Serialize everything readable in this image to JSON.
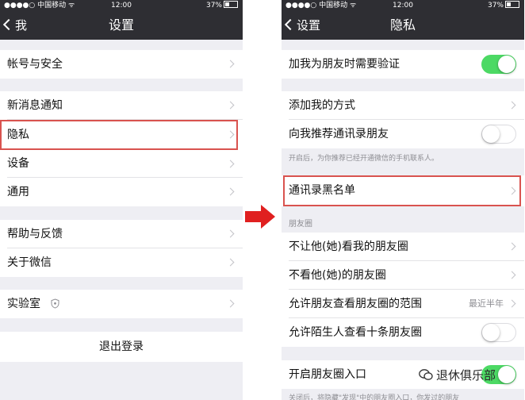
{
  "left": {
    "status": {
      "carrier": "●●●●○ 中国移动 ᯤ",
      "time": "12:00",
      "battery": "37%"
    },
    "nav": {
      "back_label": "我",
      "title": "设置"
    },
    "rows": [
      "帐号与安全",
      "新消息通知",
      "隐私",
      "设备",
      "通用",
      "帮助与反馈",
      "关于微信",
      "实验室"
    ],
    "logout": "退出登录"
  },
  "right": {
    "status": {
      "carrier": "●●●●○ 中国移动 ᯤ",
      "time": "12:00",
      "battery": "37%"
    },
    "nav": {
      "back_label": "设置",
      "title": "隐私"
    },
    "verify_label": "加我为朋友时需要验证",
    "verify_on": true,
    "add_methods_label": "添加我的方式",
    "recommend_label": "向我推荐通讯录朋友",
    "recommend_on": false,
    "recommend_note": "开启后，为你推荐已经开通微信的手机联系人。",
    "blacklist_label": "通讯录黑名单",
    "moments_header": "朋友圈",
    "hide_from_label": "不让他(她)看我的朋友圈",
    "dont_see_label": "不看他(她)的朋友圈",
    "range_label": "允许朋友查看朋友圈的范围",
    "range_value": "最近半年",
    "stranger_label": "允许陌生人查看十条朋友圈",
    "stranger_on": false,
    "entry_label": "开启朋友圈入口",
    "entry_on": true,
    "entry_note": "关闭后，将隐藏\"发现\"中的朋友圈入口，你发过的朋友"
  },
  "watermark": "退休俱乐部",
  "colors": {
    "highlight": "#d9534f",
    "arrow": "#e02020",
    "toggle_on": "#4cd964",
    "nav_bg": "#2e2e33"
  }
}
